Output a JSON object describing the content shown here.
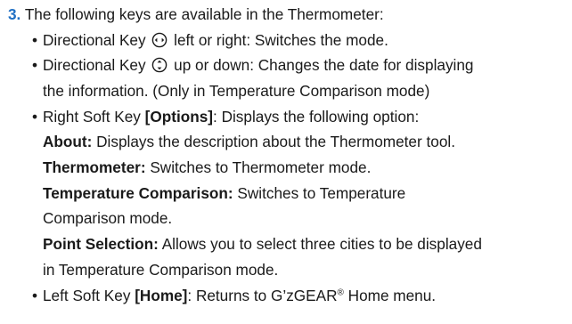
{
  "step": {
    "number": "3.",
    "intro": "The following keys are available in the Thermometer:"
  },
  "items": [
    {
      "bullet": "•",
      "label": "Directional Key",
      "text": " left or right: Switches the mode."
    },
    {
      "bullet": "•",
      "label": "Directional Key",
      "text_line1": " up or down: Changes the date for displaying",
      "text_line2": "the information. (Only in Temperature Comparison mode)"
    },
    {
      "bullet": "•",
      "label": "Right Soft Key ",
      "key": "[Options]",
      "text": ": Displays the following option:"
    },
    {
      "bullet": "•",
      "label": "Left Soft Key ",
      "key": "[Home]",
      "text_before": ": Returns to G’zGEAR",
      "reg": "®",
      "text_after": " Home menu."
    }
  ],
  "options": [
    {
      "term": "About:",
      "desc": " Displays the description about the Thermometer tool."
    },
    {
      "term": "Thermometer:",
      "desc": " Switches to Thermometer mode."
    },
    {
      "term": "Temperature Comparison:",
      "desc_line1": " Switches to Temperature",
      "desc_line2": "Comparison mode."
    },
    {
      "term": "Point Selection:",
      "desc_line1": " Allows you to select three cities to be displayed",
      "desc_line2": "in Temperature Comparison mode."
    }
  ],
  "icons": {
    "lr": "left-right-directional-key-icon",
    "ud": "up-down-directional-key-icon"
  },
  "colors": {
    "accent": "#1f6fc4",
    "text": "#1a1a1a"
  }
}
